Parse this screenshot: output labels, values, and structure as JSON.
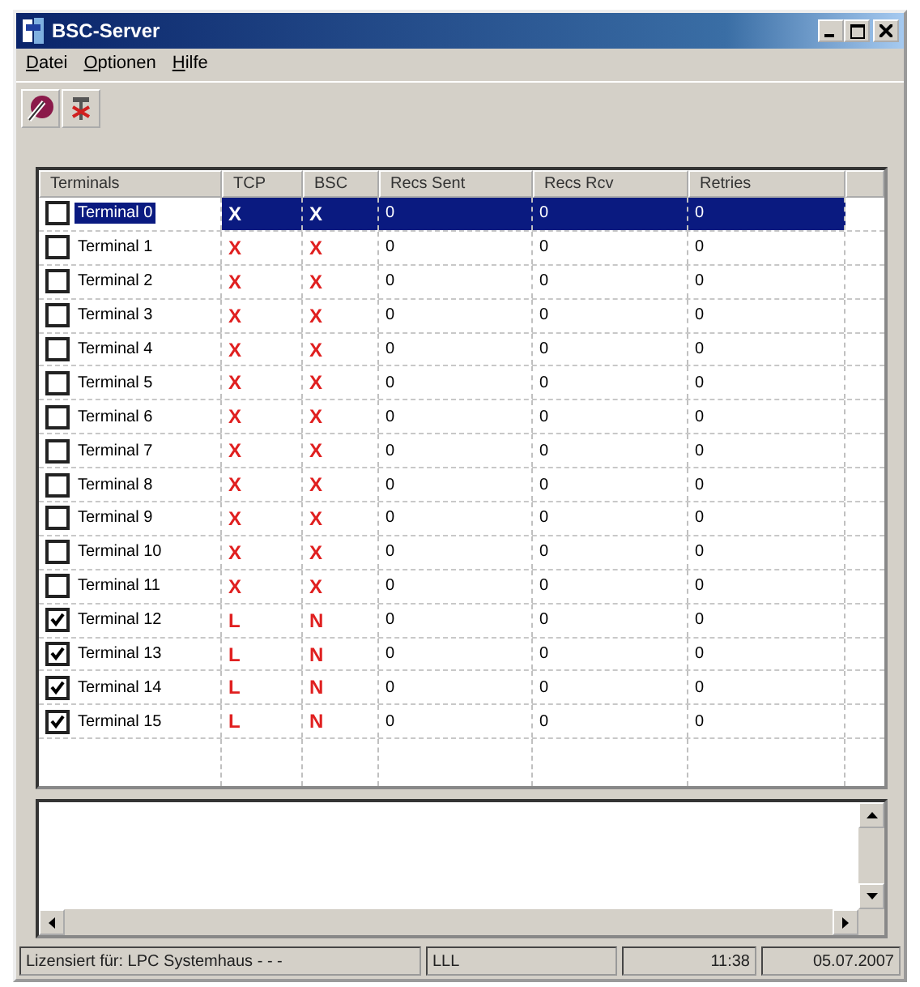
{
  "window": {
    "title": "BSC-Server"
  },
  "menu": [
    {
      "label": "Datei"
    },
    {
      "label": "Optionen"
    },
    {
      "label": "Hilfe"
    }
  ],
  "table": {
    "columns": [
      "Terminals",
      "TCP",
      "BSC",
      "Recs Sent",
      "Recs Rcv",
      "Retries"
    ],
    "rows": [
      {
        "checked": false,
        "selected": true,
        "name": "Terminal 0",
        "tcp": "X",
        "bsc": "X",
        "recs_sent": "0",
        "recs_rcv": "0",
        "retries": "0"
      },
      {
        "checked": false,
        "selected": false,
        "name": "Terminal 1",
        "tcp": "X",
        "bsc": "X",
        "recs_sent": "0",
        "recs_rcv": "0",
        "retries": "0"
      },
      {
        "checked": false,
        "selected": false,
        "name": "Terminal 2",
        "tcp": "X",
        "bsc": "X",
        "recs_sent": "0",
        "recs_rcv": "0",
        "retries": "0"
      },
      {
        "checked": false,
        "selected": false,
        "name": "Terminal 3",
        "tcp": "X",
        "bsc": "X",
        "recs_sent": "0",
        "recs_rcv": "0",
        "retries": "0"
      },
      {
        "checked": false,
        "selected": false,
        "name": "Terminal 4",
        "tcp": "X",
        "bsc": "X",
        "recs_sent": "0",
        "recs_rcv": "0",
        "retries": "0"
      },
      {
        "checked": false,
        "selected": false,
        "name": "Terminal 5",
        "tcp": "X",
        "bsc": "X",
        "recs_sent": "0",
        "recs_rcv": "0",
        "retries": "0"
      },
      {
        "checked": false,
        "selected": false,
        "name": "Terminal 6",
        "tcp": "X",
        "bsc": "X",
        "recs_sent": "0",
        "recs_rcv": "0",
        "retries": "0"
      },
      {
        "checked": false,
        "selected": false,
        "name": "Terminal 7",
        "tcp": "X",
        "bsc": "X",
        "recs_sent": "0",
        "recs_rcv": "0",
        "retries": "0"
      },
      {
        "checked": false,
        "selected": false,
        "name": "Terminal 8",
        "tcp": "X",
        "bsc": "X",
        "recs_sent": "0",
        "recs_rcv": "0",
        "retries": "0"
      },
      {
        "checked": false,
        "selected": false,
        "name": "Terminal 9",
        "tcp": "X",
        "bsc": "X",
        "recs_sent": "0",
        "recs_rcv": "0",
        "retries": "0"
      },
      {
        "checked": false,
        "selected": false,
        "name": "Terminal 10",
        "tcp": "X",
        "bsc": "X",
        "recs_sent": "0",
        "recs_rcv": "0",
        "retries": "0"
      },
      {
        "checked": false,
        "selected": false,
        "name": "Terminal 11",
        "tcp": "X",
        "bsc": "X",
        "recs_sent": "0",
        "recs_rcv": "0",
        "retries": "0"
      },
      {
        "checked": true,
        "selected": false,
        "name": "Terminal 12",
        "tcp": "L",
        "bsc": "N",
        "recs_sent": "0",
        "recs_rcv": "0",
        "retries": "0"
      },
      {
        "checked": true,
        "selected": false,
        "name": "Terminal 13",
        "tcp": "L",
        "bsc": "N",
        "recs_sent": "0",
        "recs_rcv": "0",
        "retries": "0"
      },
      {
        "checked": true,
        "selected": false,
        "name": "Terminal 14",
        "tcp": "L",
        "bsc": "N",
        "recs_sent": "0",
        "recs_rcv": "0",
        "retries": "0"
      },
      {
        "checked": true,
        "selected": false,
        "name": "Terminal 15",
        "tcp": "L",
        "bsc": "N",
        "recs_sent": "0",
        "recs_rcv": "0",
        "retries": "0"
      }
    ]
  },
  "status_bar": [
    "Lizensiert für: LPC Systemhaus - - -",
    "LLL",
    "11:38",
    "05.07.2007"
  ]
}
